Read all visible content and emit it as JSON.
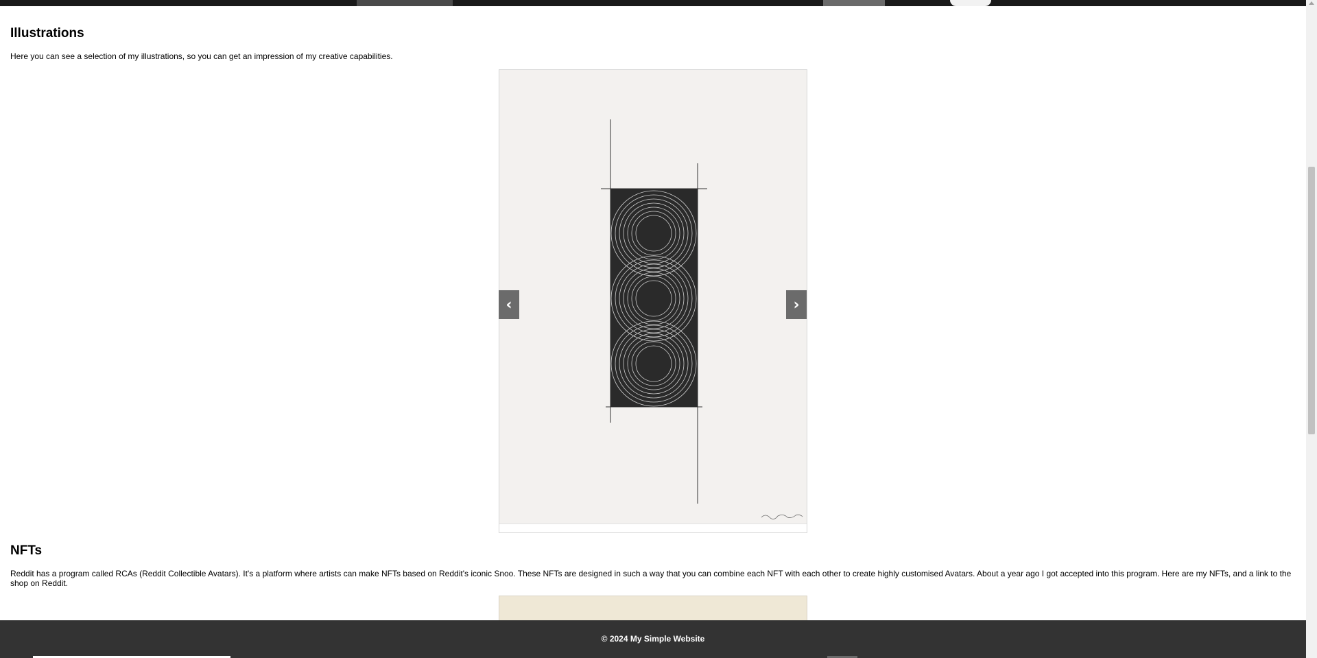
{
  "sections": {
    "illustrations": {
      "heading": "Illustrations",
      "description": "Here you can see a selection of my illustrations, so you can get an impression of my creative capabilities."
    },
    "nfts": {
      "heading": "NFTs",
      "description": "Reddit has a program called RCAs (Reddit Collectible Avatars). It's a platform where artists can make NFTs based on Reddit's iconic Snoo. These NFTs are designed in such a way that you can combine each NFT with each other to create highly customised Avatars. About a year ago I got accepted into this program. Here are my NFTs, and a link to the shop on Reddit."
    }
  },
  "carousel": {
    "prev_label": "‹",
    "next_label": "›"
  },
  "footer": {
    "text": "© 2024 My Simple Website"
  }
}
